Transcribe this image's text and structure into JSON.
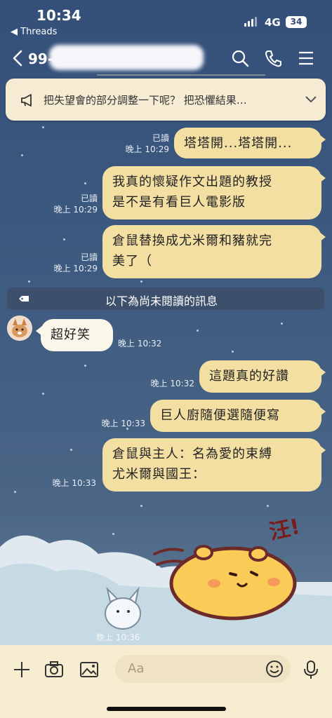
{
  "status_bar": {
    "time": "10:34",
    "back_app": "◀ Threads",
    "network": "4G",
    "battery": "34"
  },
  "header": {
    "title": "99-"
  },
  "announcement": {
    "text": "把失望會的部分調整一下呢？ 把恐懼結果…"
  },
  "messages": [
    {
      "dir": "out",
      "text": "塔塔開...塔塔開...",
      "read": "已讀",
      "time": "晚上 10:29"
    },
    {
      "dir": "out",
      "text": "我真的懷疑作文出題的教授\n是不是有看巨人電影版",
      "read": "已讀",
      "time": "晚上 10:29"
    },
    {
      "dir": "out",
      "text": "倉鼠替換成尤米爾和豬就完\n美了（",
      "read": "已讀",
      "time": "晚上 10:29"
    },
    {
      "dir": "in",
      "text": "超好笑",
      "time": "晚上 10:32"
    },
    {
      "dir": "out",
      "text": "這題真的好讚",
      "time": "晚上 10:32"
    },
    {
      "dir": "out",
      "text": "巨人廚隨便選隨便寫",
      "time": "晚上 10:33"
    },
    {
      "dir": "out",
      "text": "倉鼠與主人：名為愛的束縛\n尤米爾與國王：",
      "time": "晚上 10:33"
    }
  ],
  "unread_divider": "以下為尚未閱讀的訊息",
  "sticker": {
    "text": "汪!",
    "time": "晚上 10:36"
  },
  "input": {
    "placeholder": "Aa"
  },
  "colors": {
    "outgoing_bubble": "#f3dfa2",
    "incoming_bubble": "#fbf6ea",
    "input_bar": "#f7edd0",
    "background": "#3f5a7d"
  }
}
